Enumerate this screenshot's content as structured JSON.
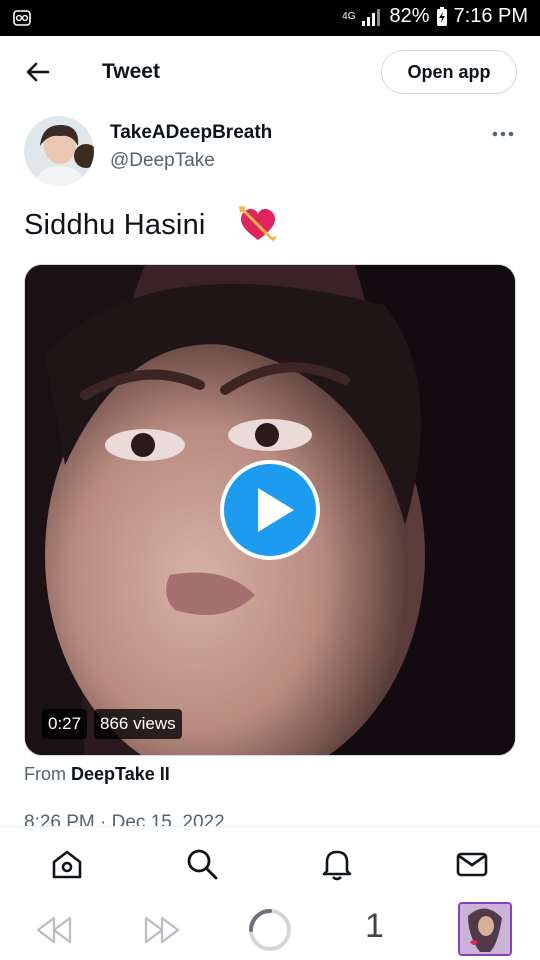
{
  "status_bar": {
    "network": "4G",
    "battery": "82%",
    "time": "7:16 PM",
    "icons": [
      "notification-icon",
      "signal-icon",
      "battery-icon"
    ]
  },
  "header": {
    "title": "Tweet",
    "open_app_label": "Open app"
  },
  "tweet": {
    "author_name": "TakeADeepBreath",
    "author_handle": "@DeepTake",
    "text": "Siddhu Hasini",
    "emoji_icon": "heart-with-arrow-icon",
    "video": {
      "duration": "0:27",
      "views": "866 views"
    },
    "from_label": "From",
    "from_source": "DeepTake II",
    "timestamp": "8:26 PM · Dec 15, 2022"
  },
  "nav": {
    "items": [
      "home-icon",
      "search-icon",
      "notifications-icon",
      "messages-icon"
    ]
  },
  "browser_toolbar": {
    "tab_count": "1",
    "icons": [
      "back-icon",
      "forward-icon",
      "reload-icon"
    ]
  },
  "colors": {
    "accent": "#1d9bf0",
    "text": "#0f1419",
    "secondary_text": "#536471",
    "tab_border": "#8b3fb8"
  }
}
